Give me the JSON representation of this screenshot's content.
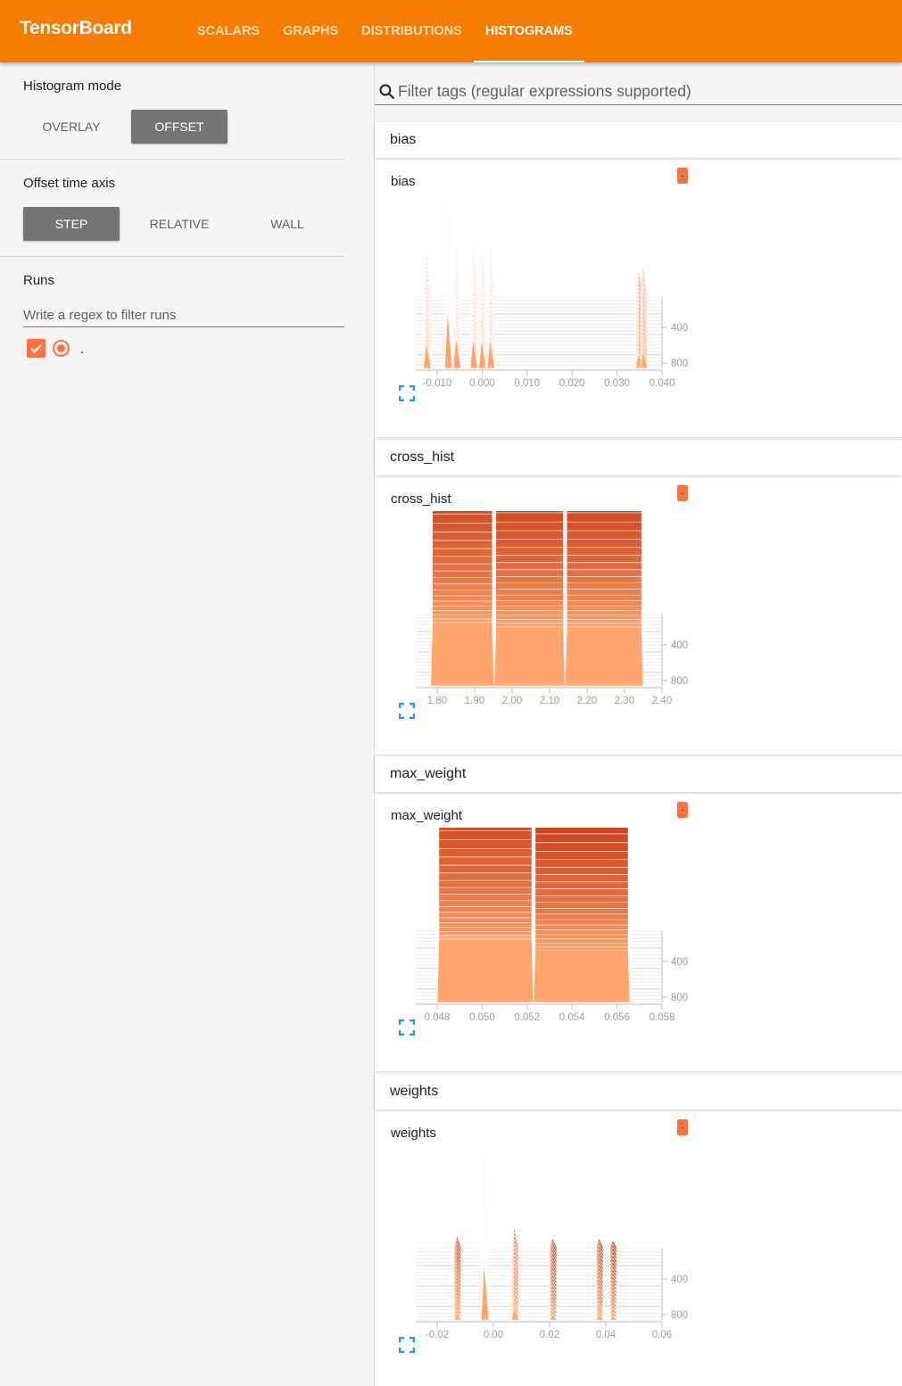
{
  "header": {
    "brand": "TensorBoard",
    "tabs": [
      {
        "label": "SCALARS",
        "active": false
      },
      {
        "label": "GRAPHS",
        "active": false
      },
      {
        "label": "DISTRIBUTIONS",
        "active": false
      },
      {
        "label": "HISTOGRAMS",
        "active": true
      }
    ],
    "color": "#f57c00"
  },
  "sidebar": {
    "histogram_mode": {
      "label": "Histogram mode",
      "options": [
        "OVERLAY",
        "OFFSET"
      ],
      "selected": "OFFSET"
    },
    "offset_time_axis": {
      "label": "Offset time axis",
      "options": [
        "STEP",
        "RELATIVE",
        "WALL"
      ],
      "selected": "STEP"
    },
    "runs": {
      "label": "Runs",
      "filter_placeholder": "Write a regex to filter runs",
      "items": [
        {
          "name": ".",
          "checked": true,
          "selected": true,
          "color": "#ff7043"
        }
      ]
    }
  },
  "main": {
    "search_placeholder": "Filter tags (regular expressions supported)",
    "run_chip_label": "."
  },
  "chart_data": [
    {
      "type": "histogram",
      "category": "bias",
      "title": "bias",
      "x_ticks": [
        "-0.010",
        "0.000",
        "0.010",
        "0.020",
        "0.030",
        "0.040"
      ],
      "x_range": [
        -0.014,
        0.044
      ],
      "y_ticks": [
        "400",
        "800"
      ],
      "y_range": [
        0,
        1000
      ],
      "mode": "offset",
      "peaks": [
        {
          "x": -0.0115,
          "h": 0.45
        },
        {
          "x": -0.0065,
          "h": 1.0
        },
        {
          "x": -0.0045,
          "h": 0.55
        },
        {
          "x": -0.0005,
          "h": 0.5
        },
        {
          "x": 0.0015,
          "h": 0.48
        },
        {
          "x": 0.0035,
          "h": 0.5
        },
        {
          "x": 0.0385,
          "h": 0.25
        },
        {
          "x": 0.0395,
          "h": 0.3
        }
      ]
    },
    {
      "type": "histogram",
      "category": "cross_hist",
      "title": "cross_hist",
      "x_ticks": [
        "1.80",
        "1.90",
        "2.00",
        "2.10",
        "2.20",
        "2.30",
        "2.40"
      ],
      "x_range": [
        1.76,
        2.42
      ],
      "y_ticks": [
        "400",
        "800"
      ],
      "y_range": [
        0,
        1000
      ],
      "mode": "offset",
      "blocks": [
        {
          "x0": 1.8,
          "x1": 1.97,
          "h": 1.0
        },
        {
          "x0": 1.97,
          "x1": 2.16,
          "h": 0.93
        },
        {
          "x0": 2.16,
          "x1": 2.37,
          "h": 0.93
        }
      ]
    },
    {
      "type": "histogram",
      "category": "max_weight",
      "title": "max_weight",
      "x_ticks": [
        "0.048",
        "0.050",
        "0.052",
        "0.054",
        "0.056",
        "0.058"
      ],
      "x_range": [
        0.047,
        0.0585
      ],
      "y_ticks": [
        "400",
        "800"
      ],
      "y_range": [
        0,
        1000
      ],
      "mode": "offset",
      "blocks": [
        {
          "x0": 0.048,
          "x1": 0.0525,
          "h": 1.0
        },
        {
          "x0": 0.0525,
          "x1": 0.057,
          "h": 0.82
        }
      ]
    },
    {
      "type": "histogram",
      "category": "weights",
      "title": "weights",
      "x_ticks": [
        "-0.02",
        "0.00",
        "0.02",
        "0.04",
        "0.06"
      ],
      "x_range": [
        -0.03,
        0.06
      ],
      "y_ticks": [
        "400",
        "800"
      ],
      "y_range": [
        0,
        1000
      ],
      "mode": "offset",
      "peaks": [
        {
          "x": -0.005,
          "h": 1.0
        },
        {
          "x": -0.015,
          "h": 0.12
        },
        {
          "x": 0.006,
          "h": 0.2
        },
        {
          "x": 0.02,
          "h": 0.1
        },
        {
          "x": 0.037,
          "h": 0.1
        },
        {
          "x": 0.042,
          "h": 0.08
        }
      ]
    }
  ]
}
